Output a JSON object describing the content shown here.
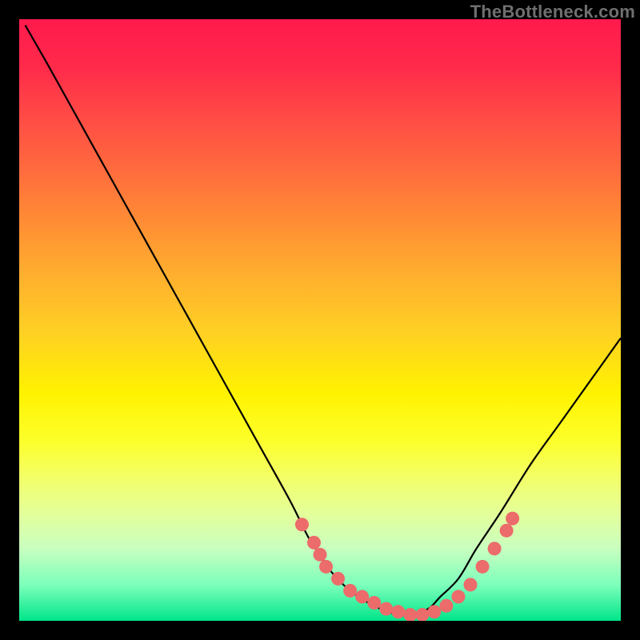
{
  "watermark": "TheBottleneck.com",
  "colors": {
    "background": "#000000",
    "curve_stroke": "#000000",
    "marker_fill": "#ec6b6b",
    "marker_stroke": "#d85a5a"
  },
  "chart_data": {
    "type": "line",
    "title": "",
    "xlabel": "",
    "ylabel": "",
    "xlim": [
      0,
      100
    ],
    "ylim": [
      0,
      100
    ],
    "grid": false,
    "legend": false,
    "series": [
      {
        "name": "bottleneck-curve",
        "x": [
          1,
          5,
          10,
          15,
          20,
          25,
          30,
          35,
          40,
          45,
          48,
          50,
          52,
          55,
          58,
          60,
          63,
          65,
          68,
          70,
          73,
          76,
          80,
          85,
          90,
          95,
          100
        ],
        "y": [
          99,
          92,
          83,
          74,
          65,
          56,
          47,
          38,
          29,
          20,
          14,
          11,
          8,
          5,
          3,
          2,
          1,
          1,
          2,
          4,
          7,
          12,
          18,
          26,
          33,
          40,
          47
        ]
      }
    ],
    "markers": {
      "name": "highlight-dots",
      "x": [
        47,
        49,
        50,
        51,
        53,
        55,
        57,
        59,
        61,
        63,
        65,
        67,
        69,
        71,
        73,
        75,
        77,
        79,
        81,
        82
      ],
      "y": [
        16,
        13,
        11,
        9,
        7,
        5,
        4,
        3,
        2,
        1.5,
        1,
        1,
        1.5,
        2.5,
        4,
        6,
        9,
        12,
        15,
        17
      ]
    }
  }
}
